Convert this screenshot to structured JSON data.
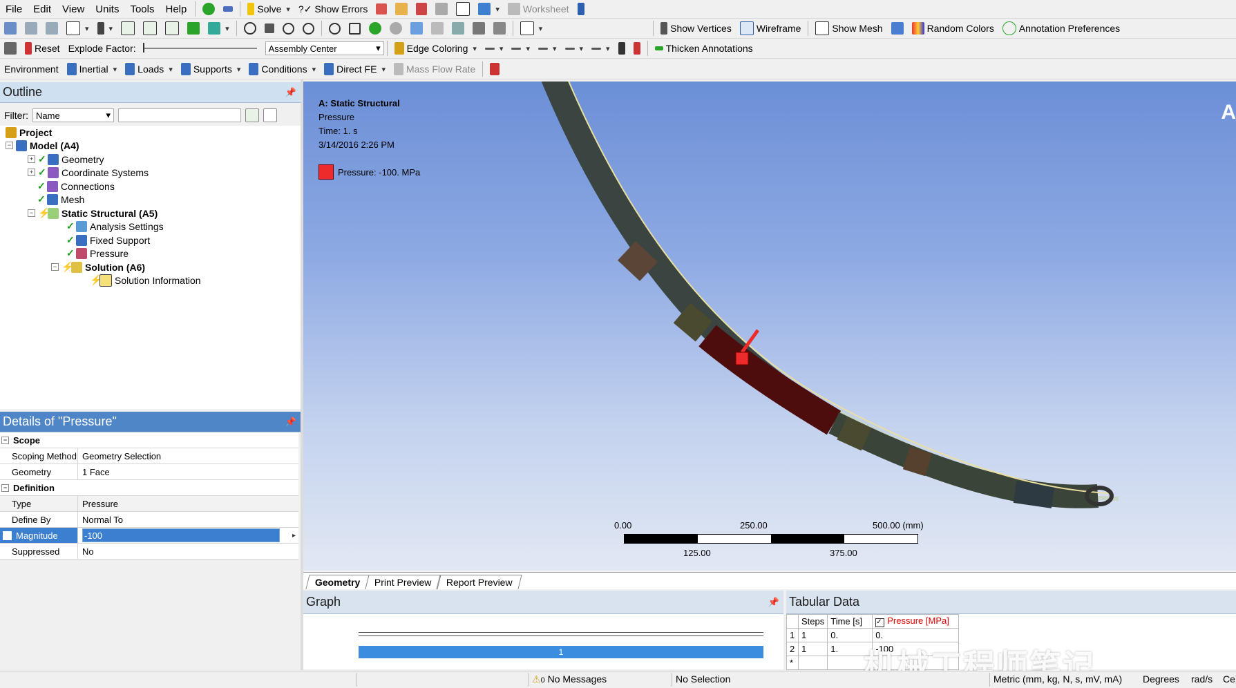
{
  "menubar": {
    "items": [
      "File",
      "Edit",
      "View",
      "Units",
      "Tools",
      "Help"
    ]
  },
  "toolbar1": {
    "solve": "Solve",
    "show_errors": "?✓ Show Errors",
    "worksheet": "Worksheet",
    "show_vertices": "Show Vertices",
    "wireframe": "Wireframe",
    "show_mesh": "Show Mesh",
    "random_colors": "Random Colors",
    "annotation_prefs": "Annotation Preferences"
  },
  "toolbar2": {
    "reset": "Reset",
    "explode_factor": "Explode Factor:",
    "assembly_center": "Assembly Center",
    "edge_coloring": "Edge Coloring",
    "thicken_annotations": "Thicken Annotations"
  },
  "toolbar3": {
    "environment": "Environment",
    "inertial": "Inertial",
    "loads": "Loads",
    "supports": "Supports",
    "conditions": "Conditions",
    "direct_fe": "Direct FE",
    "mass_flow_rate": "Mass Flow Rate"
  },
  "outline": {
    "title": "Outline",
    "filter_label": "Filter:",
    "filter_value": "Name",
    "tree": [
      {
        "label": "Project",
        "bold": true
      },
      {
        "label": "Model (A4)",
        "bold": true
      },
      {
        "label": "Geometry"
      },
      {
        "label": "Coordinate Systems"
      },
      {
        "label": "Connections"
      },
      {
        "label": "Mesh"
      },
      {
        "label": "Static Structural (A5)",
        "bold": true
      },
      {
        "label": "Analysis Settings"
      },
      {
        "label": "Fixed Support"
      },
      {
        "label": "Pressure"
      },
      {
        "label": "Solution (A6)",
        "bold": true
      },
      {
        "label": "Solution Information"
      }
    ]
  },
  "details": {
    "title": "Details of \"Pressure\"",
    "sections": {
      "scope": "Scope",
      "definition": "Definition"
    },
    "rows": {
      "scoping_method": {
        "key": "Scoping Method",
        "value": "Geometry Selection"
      },
      "geometry": {
        "key": "Geometry",
        "value": "1 Face"
      },
      "type": {
        "key": "Type",
        "value": "Pressure"
      },
      "define_by": {
        "key": "Define By",
        "value": "Normal To"
      },
      "magnitude": {
        "key": "Magnitude",
        "value": "-100"
      },
      "suppressed": {
        "key": "Suppressed",
        "value": "No"
      }
    }
  },
  "viewport": {
    "title": "A: Static Structural",
    "subtitle": "Pressure",
    "time": "Time: 1. s",
    "date": "3/14/2016 2:26 PM",
    "legend": "Pressure: -100. MPa",
    "legend_color": "#ee2b2b",
    "corner_letter": "A",
    "scale": {
      "t0": "0.00",
      "t250": "250.00",
      "t500": "500.00 (mm)",
      "t125": "125.00",
      "t375": "375.00"
    }
  },
  "view_tabs": [
    "Geometry",
    "Print Preview",
    "Report Preview"
  ],
  "graph": {
    "title": "Graph",
    "step_label": "1"
  },
  "tabular": {
    "title": "Tabular Data",
    "headers": [
      "Steps",
      "Time [s]",
      "Pressure [MPa]"
    ],
    "rows": [
      {
        "idx": "1",
        "steps": "1",
        "time": "0.",
        "pressure": "0."
      },
      {
        "idx": "2",
        "steps": "1",
        "time": "1.",
        "pressure": "-100"
      },
      {
        "idx": "*",
        "steps": "",
        "time": "",
        "pressure": ""
      }
    ]
  },
  "status": {
    "messages": "No Messages",
    "messages_count": "0",
    "selection": "No Selection",
    "units": "Metric (mm, kg, N, s, mV, mA)",
    "degrees": "Degrees",
    "rads": "rad/s",
    "tail": "Ce"
  },
  "watermark": "机械工程师笔记"
}
